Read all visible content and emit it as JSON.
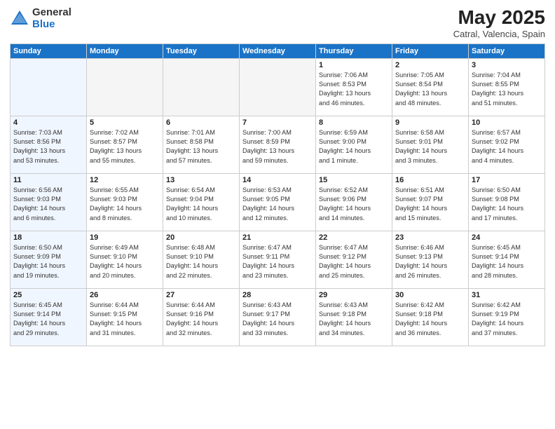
{
  "logo": {
    "general": "General",
    "blue": "Blue"
  },
  "title": "May 2025",
  "subtitle": "Catral, Valencia, Spain",
  "days_header": [
    "Sunday",
    "Monday",
    "Tuesday",
    "Wednesday",
    "Thursday",
    "Friday",
    "Saturday"
  ],
  "weeks": [
    [
      {
        "day": "",
        "info": ""
      },
      {
        "day": "",
        "info": ""
      },
      {
        "day": "",
        "info": ""
      },
      {
        "day": "",
        "info": ""
      },
      {
        "day": "1",
        "info": "Sunrise: 7:06 AM\nSunset: 8:53 PM\nDaylight: 13 hours\nand 46 minutes."
      },
      {
        "day": "2",
        "info": "Sunrise: 7:05 AM\nSunset: 8:54 PM\nDaylight: 13 hours\nand 48 minutes."
      },
      {
        "day": "3",
        "info": "Sunrise: 7:04 AM\nSunset: 8:55 PM\nDaylight: 13 hours\nand 51 minutes."
      }
    ],
    [
      {
        "day": "4",
        "info": "Sunrise: 7:03 AM\nSunset: 8:56 PM\nDaylight: 13 hours\nand 53 minutes."
      },
      {
        "day": "5",
        "info": "Sunrise: 7:02 AM\nSunset: 8:57 PM\nDaylight: 13 hours\nand 55 minutes."
      },
      {
        "day": "6",
        "info": "Sunrise: 7:01 AM\nSunset: 8:58 PM\nDaylight: 13 hours\nand 57 minutes."
      },
      {
        "day": "7",
        "info": "Sunrise: 7:00 AM\nSunset: 8:59 PM\nDaylight: 13 hours\nand 59 minutes."
      },
      {
        "day": "8",
        "info": "Sunrise: 6:59 AM\nSunset: 9:00 PM\nDaylight: 14 hours\nand 1 minute."
      },
      {
        "day": "9",
        "info": "Sunrise: 6:58 AM\nSunset: 9:01 PM\nDaylight: 14 hours\nand 3 minutes."
      },
      {
        "day": "10",
        "info": "Sunrise: 6:57 AM\nSunset: 9:02 PM\nDaylight: 14 hours\nand 4 minutes."
      }
    ],
    [
      {
        "day": "11",
        "info": "Sunrise: 6:56 AM\nSunset: 9:03 PM\nDaylight: 14 hours\nand 6 minutes."
      },
      {
        "day": "12",
        "info": "Sunrise: 6:55 AM\nSunset: 9:03 PM\nDaylight: 14 hours\nand 8 minutes."
      },
      {
        "day": "13",
        "info": "Sunrise: 6:54 AM\nSunset: 9:04 PM\nDaylight: 14 hours\nand 10 minutes."
      },
      {
        "day": "14",
        "info": "Sunrise: 6:53 AM\nSunset: 9:05 PM\nDaylight: 14 hours\nand 12 minutes."
      },
      {
        "day": "15",
        "info": "Sunrise: 6:52 AM\nSunset: 9:06 PM\nDaylight: 14 hours\nand 14 minutes."
      },
      {
        "day": "16",
        "info": "Sunrise: 6:51 AM\nSunset: 9:07 PM\nDaylight: 14 hours\nand 15 minutes."
      },
      {
        "day": "17",
        "info": "Sunrise: 6:50 AM\nSunset: 9:08 PM\nDaylight: 14 hours\nand 17 minutes."
      }
    ],
    [
      {
        "day": "18",
        "info": "Sunrise: 6:50 AM\nSunset: 9:09 PM\nDaylight: 14 hours\nand 19 minutes."
      },
      {
        "day": "19",
        "info": "Sunrise: 6:49 AM\nSunset: 9:10 PM\nDaylight: 14 hours\nand 20 minutes."
      },
      {
        "day": "20",
        "info": "Sunrise: 6:48 AM\nSunset: 9:10 PM\nDaylight: 14 hours\nand 22 minutes."
      },
      {
        "day": "21",
        "info": "Sunrise: 6:47 AM\nSunset: 9:11 PM\nDaylight: 14 hours\nand 23 minutes."
      },
      {
        "day": "22",
        "info": "Sunrise: 6:47 AM\nSunset: 9:12 PM\nDaylight: 14 hours\nand 25 minutes."
      },
      {
        "day": "23",
        "info": "Sunrise: 6:46 AM\nSunset: 9:13 PM\nDaylight: 14 hours\nand 26 minutes."
      },
      {
        "day": "24",
        "info": "Sunrise: 6:45 AM\nSunset: 9:14 PM\nDaylight: 14 hours\nand 28 minutes."
      }
    ],
    [
      {
        "day": "25",
        "info": "Sunrise: 6:45 AM\nSunset: 9:14 PM\nDaylight: 14 hours\nand 29 minutes."
      },
      {
        "day": "26",
        "info": "Sunrise: 6:44 AM\nSunset: 9:15 PM\nDaylight: 14 hours\nand 31 minutes."
      },
      {
        "day": "27",
        "info": "Sunrise: 6:44 AM\nSunset: 9:16 PM\nDaylight: 14 hours\nand 32 minutes."
      },
      {
        "day": "28",
        "info": "Sunrise: 6:43 AM\nSunset: 9:17 PM\nDaylight: 14 hours\nand 33 minutes."
      },
      {
        "day": "29",
        "info": "Sunrise: 6:43 AM\nSunset: 9:18 PM\nDaylight: 14 hours\nand 34 minutes."
      },
      {
        "day": "30",
        "info": "Sunrise: 6:42 AM\nSunset: 9:18 PM\nDaylight: 14 hours\nand 36 minutes."
      },
      {
        "day": "31",
        "info": "Sunrise: 6:42 AM\nSunset: 9:19 PM\nDaylight: 14 hours\nand 37 minutes."
      }
    ]
  ]
}
